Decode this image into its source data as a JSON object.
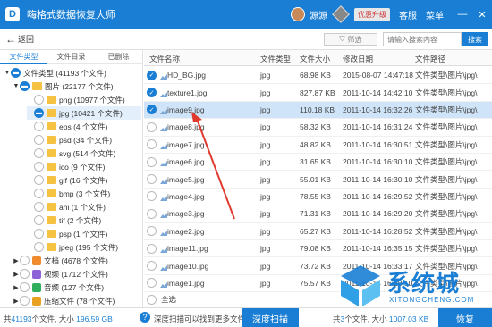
{
  "titlebar": {
    "title": "嗨格式数据恢复大师",
    "username": "源源",
    "vip_label": "优惠升级",
    "service": "客服",
    "menu": "菜单",
    "minimize": "—",
    "close": "✕"
  },
  "nav": {
    "back": "返回",
    "filter": "筛选",
    "search_placeholder": "请输入搜索内容",
    "search_btn": "搜索"
  },
  "left_tabs": [
    "文件类型",
    "文件目录",
    "已删除"
  ],
  "tree": [
    {
      "label": "文件类型 (41193 个文件)",
      "level": 0,
      "state": "checked",
      "toggle": "▼"
    },
    {
      "label": "图片 (22177 个文件)",
      "level": 1,
      "state": "checked",
      "toggle": "▼",
      "icon": "folder"
    },
    {
      "label": "png (10977 个文件)",
      "level": 2,
      "state": "empty",
      "icon": "folder"
    },
    {
      "label": "jpg (10421 个文件)",
      "level": 2,
      "state": "checked",
      "icon": "folder",
      "selected": true
    },
    {
      "label": "eps (4 个文件)",
      "level": 2,
      "state": "empty",
      "icon": "folder"
    },
    {
      "label": "psd (34 个文件)",
      "level": 2,
      "state": "empty",
      "icon": "folder"
    },
    {
      "label": "svg (514 个文件)",
      "level": 2,
      "state": "empty",
      "icon": "folder"
    },
    {
      "label": "ico (9 个文件)",
      "level": 2,
      "state": "empty",
      "icon": "folder"
    },
    {
      "label": "gif (16 个文件)",
      "level": 2,
      "state": "empty",
      "icon": "folder"
    },
    {
      "label": "bmp (3 个文件)",
      "level": 2,
      "state": "empty",
      "icon": "folder"
    },
    {
      "label": "ani (1 个文件)",
      "level": 2,
      "state": "empty",
      "icon": "folder"
    },
    {
      "label": "tif (2 个文件)",
      "level": 2,
      "state": "empty",
      "icon": "folder"
    },
    {
      "label": "psp (1 个文件)",
      "level": 2,
      "state": "empty",
      "icon": "folder"
    },
    {
      "label": "jpeg (195 个文件)",
      "level": 2,
      "state": "empty",
      "icon": "folder"
    },
    {
      "label": "文档 (4678 个文件)",
      "level": 1,
      "state": "empty",
      "toggle": "▶",
      "icon": "doc"
    },
    {
      "label": "视频 (1712 个文件)",
      "level": 1,
      "state": "empty",
      "toggle": "▶",
      "icon": "video"
    },
    {
      "label": "音频 (127 个文件)",
      "level": 1,
      "state": "empty",
      "toggle": "▶",
      "icon": "audio"
    },
    {
      "label": "压缩文件 (78 个文件)",
      "level": 1,
      "state": "empty",
      "toggle": "▶",
      "icon": "zip"
    },
    {
      "label": "其他 (12421 个文件)",
      "level": 1,
      "state": "empty",
      "toggle": "▶",
      "icon": "other"
    }
  ],
  "icon_colors": {
    "folder": "#f5c242",
    "doc": "#f08a2c",
    "video": "#8e63d8",
    "audio": "#2fae5c",
    "zip": "#e8a220",
    "other": "#d85a5a"
  },
  "table": {
    "headers": [
      "文件名称",
      "文件类型",
      "文件大小",
      "修改日期",
      "文件路径"
    ],
    "rows": [
      {
        "name": "HD_BG.jpg",
        "type": "jpg",
        "size": "68.98 KB",
        "date": "2015-08-07 14:47:18",
        "path": "文件类型\\图片\\jpg\\",
        "checked": true
      },
      {
        "name": "texture1.jpg",
        "type": "jpg",
        "size": "827.87 KB",
        "date": "2011-10-14 14:42:10",
        "path": "文件类型\\图片\\jpg\\",
        "checked": true
      },
      {
        "name": "image9.jpg",
        "type": "jpg",
        "size": "110.18 KB",
        "date": "2011-10-14 16:32:26",
        "path": "文件类型\\图片\\jpg\\",
        "checked": true,
        "selected": true
      },
      {
        "name": "image8.jpg",
        "type": "jpg",
        "size": "58.32 KB",
        "date": "2011-10-14 16:31:24",
        "path": "文件类型\\图片\\jpg\\",
        "checked": false
      },
      {
        "name": "image7.jpg",
        "type": "jpg",
        "size": "48.82 KB",
        "date": "2011-10-14 16:30:51",
        "path": "文件类型\\图片\\jpg\\",
        "checked": false
      },
      {
        "name": "image6.jpg",
        "type": "jpg",
        "size": "31.65 KB",
        "date": "2011-10-14 16:30:10",
        "path": "文件类型\\图片\\jpg\\",
        "checked": false
      },
      {
        "name": "image5.jpg",
        "type": "jpg",
        "size": "55.01 KB",
        "date": "2011-10-14 16:30:10",
        "path": "文件类型\\图片\\jpg\\",
        "checked": false
      },
      {
        "name": "image4.jpg",
        "type": "jpg",
        "size": "78.55 KB",
        "date": "2011-10-14 16:29:52",
        "path": "文件类型\\图片\\jpg\\",
        "checked": false
      },
      {
        "name": "image3.jpg",
        "type": "jpg",
        "size": "71.31 KB",
        "date": "2011-10-14 16:29:20",
        "path": "文件类型\\图片\\jpg\\",
        "checked": false
      },
      {
        "name": "image2.jpg",
        "type": "jpg",
        "size": "65.27 KB",
        "date": "2011-10-14 16:28:52",
        "path": "文件类型\\图片\\jpg\\",
        "checked": false
      },
      {
        "name": "image11.jpg",
        "type": "jpg",
        "size": "79.08 KB",
        "date": "2011-10-14 16:35:15",
        "path": "文件类型\\图片\\jpg\\",
        "checked": false
      },
      {
        "name": "image10.jpg",
        "type": "jpg",
        "size": "73.72 KB",
        "date": "2011-10-14 16:33:17",
        "path": "文件类型\\图片\\jpg\\",
        "checked": false
      },
      {
        "name": "image1.jpg",
        "type": "jpg",
        "size": "75.57 KB",
        "date": "2011-10-14 16:28:10",
        "path": "文件类型\\图片\\jpg\\",
        "checked": false
      }
    ],
    "select_all": "全选"
  },
  "bottom": {
    "total_prefix": "共",
    "total_count": "41193",
    "total_mid": "个文件, 大小",
    "total_size": "196.59 GB",
    "deep_hint": "深度扫描可以找到更多文件",
    "deep_btn": "深度扫描",
    "sel_prefix": "共",
    "sel_count": "3",
    "sel_suffix": "个文件, 大小",
    "sel_size": "1007.03 KB",
    "recover_btn": "恢复"
  },
  "watermark": {
    "text": "系统城",
    "sub": "XITONGCHENG.COM"
  },
  "accent_color": "#1a7fd4",
  "annotation_color": "#e03a2f"
}
